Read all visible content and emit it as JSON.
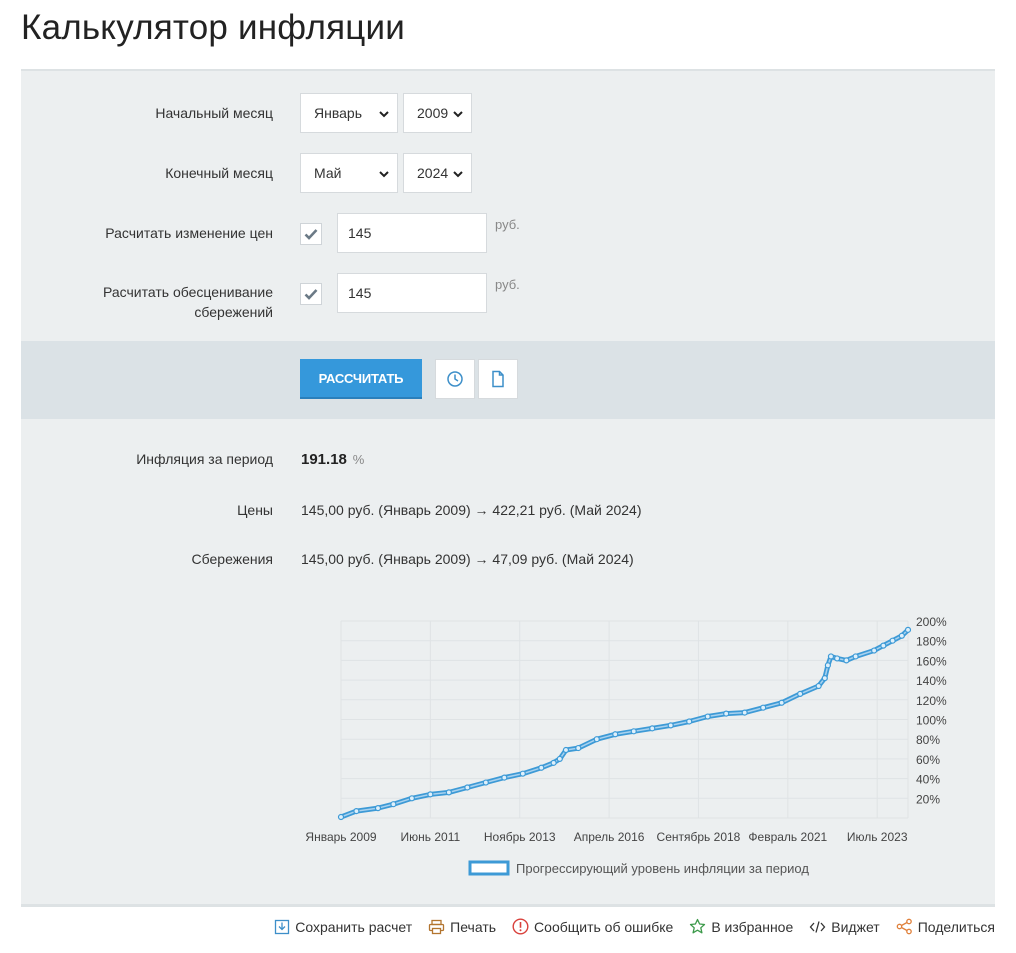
{
  "title": "Калькулятор инфляции",
  "form": {
    "start_label": "Начальный месяц",
    "start_month": "Январь",
    "start_year": "2009",
    "end_label": "Конечный месяц",
    "end_month": "Май",
    "end_year": "2024",
    "price_change_label": "Расчитать изменение цен",
    "price_change_checked": true,
    "price_change_value": "145",
    "savings_label_line1": "Расчитать обесценивание",
    "savings_label_line2": "сбережений",
    "savings_checked": true,
    "savings_value": "145",
    "unit": "руб."
  },
  "actions": {
    "calculate_label": "РАССЧИТАТЬ",
    "history_icon": "clock-icon",
    "document_icon": "document-icon",
    "accent_color": "#3598db"
  },
  "results": {
    "inflation_label": "Инфляция за период",
    "inflation_value": "191.18",
    "inflation_unit": "%",
    "prices_label": "Цены",
    "prices_value": "145,00 руб. (Январь 2009) → 422,21 руб. (Май 2024)",
    "savings_label": "Сбережения",
    "savings_value": "145,00 руб. (Январь 2009) → 47,09 руб. (Май 2024)"
  },
  "chart_data": {
    "type": "line",
    "title": "",
    "xlabel": "",
    "ylabel": "",
    "x_tick_labels": [
      "Январь 2009",
      "Июнь 2011",
      "Ноябрь 2013",
      "Апрель 2016",
      "Сентябрь 2018",
      "Февраль 2021",
      "Июль 2023"
    ],
    "y_tick_labels": [
      "20%",
      "40%",
      "60%",
      "80%",
      "100%",
      "120%",
      "140%",
      "160%",
      "180%",
      "200%"
    ],
    "ylim": [
      0,
      200
    ],
    "xlim": [
      "2009-01",
      "2024-05"
    ],
    "grid": true,
    "legend_position": "bottom",
    "series": [
      {
        "name": "Прогрессирующий уровень инфляции за период",
        "color": "#3d9ad6",
        "x": [
          "2009-01",
          "2009-06",
          "2010-01",
          "2010-06",
          "2010-12",
          "2011-06",
          "2011-12",
          "2012-06",
          "2012-12",
          "2013-06",
          "2013-12",
          "2014-06",
          "2014-10",
          "2014-12",
          "2015-02",
          "2015-06",
          "2015-12",
          "2016-06",
          "2016-12",
          "2017-06",
          "2017-12",
          "2018-06",
          "2018-12",
          "2019-06",
          "2019-12",
          "2020-06",
          "2020-12",
          "2021-06",
          "2021-12",
          "2022-02",
          "2022-03",
          "2022-04",
          "2022-06",
          "2022-09",
          "2022-12",
          "2023-06",
          "2023-09",
          "2023-12",
          "2024-03",
          "2024-05"
        ],
        "values": [
          1,
          7,
          10,
          14,
          20,
          24,
          26,
          31,
          36,
          41,
          45,
          51,
          56,
          60,
          69,
          71,
          80,
          85,
          88,
          91,
          94,
          98,
          103,
          106,
          107,
          112,
          117,
          126,
          134,
          142,
          155,
          164,
          162,
          160,
          164,
          170,
          175,
          180,
          185,
          191
        ]
      }
    ]
  },
  "footer": {
    "save_label": "Сохранить расчет",
    "print_label": "Печать",
    "report_label": "Сообщить об ошибке",
    "favorite_label": "В избранное",
    "widget_label": "Виджет",
    "share_label": "Поделиться"
  }
}
